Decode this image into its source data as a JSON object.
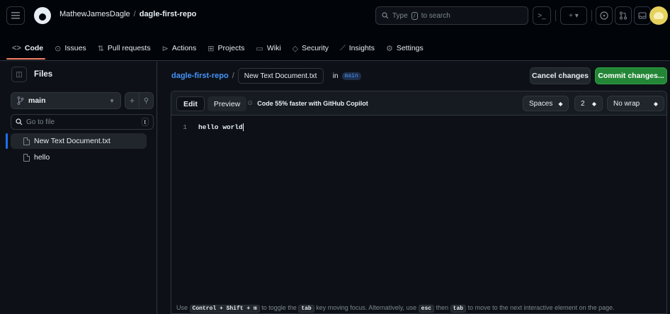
{
  "header": {
    "owner": "MathewJamesDagle",
    "separator": "/",
    "repo": "dagle-first-repo",
    "search_placeholder_pre": "Type",
    "search_key": "/",
    "search_placeholder_post": "to search",
    "terminal_label": ">_",
    "plus_label": "+ ▾"
  },
  "nav": {
    "tabs": [
      {
        "label": "Code",
        "icon": "code-icon"
      },
      {
        "label": "Issues",
        "icon": "issue-icon"
      },
      {
        "label": "Pull requests",
        "icon": "pull-request-icon"
      },
      {
        "label": "Actions",
        "icon": "play-icon"
      },
      {
        "label": "Projects",
        "icon": "table-icon"
      },
      {
        "label": "Wiki",
        "icon": "book-icon"
      },
      {
        "label": "Security",
        "icon": "shield-icon"
      },
      {
        "label": "Insights",
        "icon": "graph-icon"
      },
      {
        "label": "Settings",
        "icon": "gear-icon"
      }
    ]
  },
  "sidebar": {
    "title": "Files",
    "branch": "main",
    "goto_placeholder": "Go to file",
    "goto_key": "t",
    "files": [
      {
        "name": "New Text Document.txt",
        "selected": true
      },
      {
        "name": "hello",
        "selected": false
      }
    ]
  },
  "editor": {
    "repo_link": "dagle-first-repo",
    "separator": "/",
    "filename": "New Text Document.txt",
    "in_label": "in",
    "branch": "main",
    "cancel_label": "Cancel changes",
    "commit_label": "Commit changes...",
    "tab_edit": "Edit",
    "tab_preview": "Preview",
    "copilot_text": "Code 55% faster with GitHub Copilot",
    "indent_mode": "Spaces",
    "indent_size": "2",
    "wrap_mode": "No wrap",
    "lines": [
      {
        "number": "1",
        "text": "hello world"
      }
    ],
    "hint": {
      "p1": "Use",
      "k1": "Control + Shift + m",
      "p2": "to toggle the",
      "k2": "tab",
      "p3": "key moving focus. Alternatively, use",
      "k3": "esc",
      "p4": "then",
      "k4": "tab",
      "p5": "to move to the next interactive element on the page."
    }
  },
  "colors": {
    "accent_blue": "#4493f8",
    "commit_green": "#238636",
    "tab_underline": "#f78166",
    "background": "#0d1117"
  }
}
